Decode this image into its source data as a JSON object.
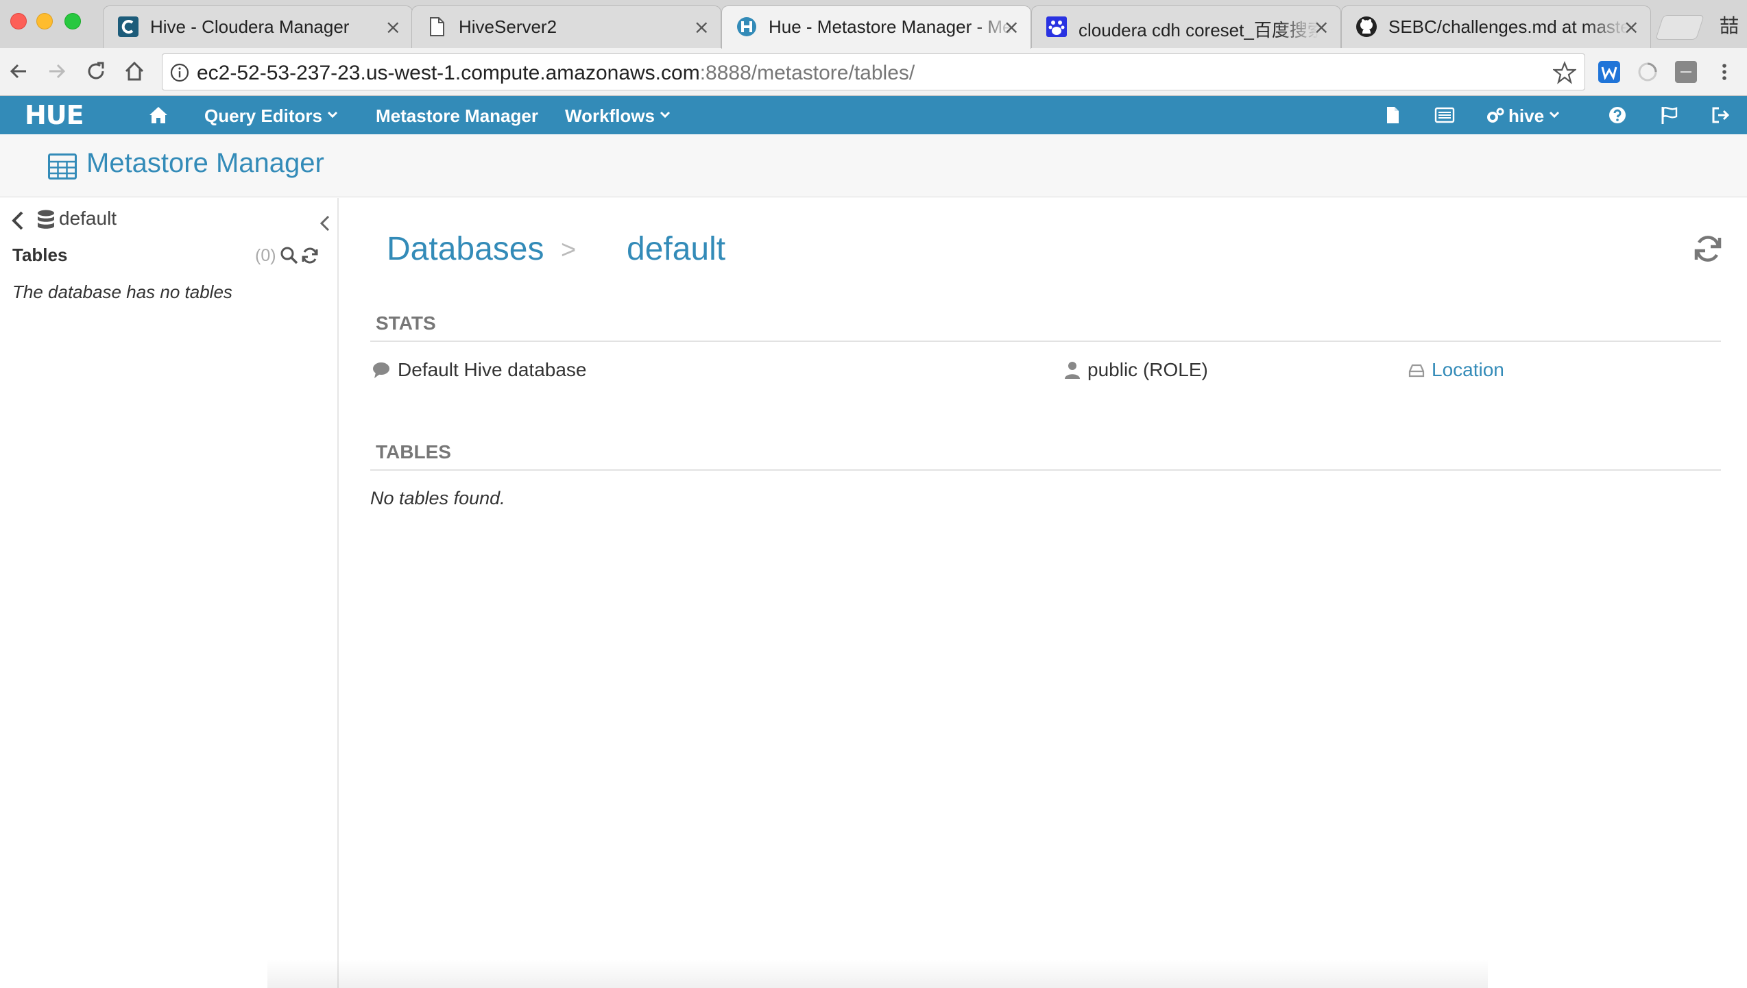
{
  "browser": {
    "tabs": [
      {
        "title": "Hive - Cloudera Manager",
        "icon": "cloudera-icon",
        "active": false
      },
      {
        "title": "HiveServer2",
        "icon": "document-icon",
        "active": false
      },
      {
        "title": "Hue - Metastore Manager - Metastore",
        "icon": "hue-icon",
        "active": true
      },
      {
        "title": "cloudera cdh coreset_百度搜索",
        "icon": "baidu-icon",
        "active": false
      },
      {
        "title": "SEBC/challenges.md at master",
        "icon": "github-icon",
        "active": false
      }
    ],
    "close_glyph": "×",
    "profile_glyph": "喆",
    "url_host": "ec2-52-53-237-23.us-west-1.compute.amazonaws.com",
    "url_rest": ":8888/metastore/tables/"
  },
  "navbar": {
    "logo": "HUE",
    "query_editors": "Query Editors",
    "metastore_manager": "Metastore Manager",
    "workflows": "Workflows",
    "user": "hive",
    "colors": {
      "bar": "#338bb8"
    }
  },
  "page": {
    "title": "Metastore Manager"
  },
  "sidebar": {
    "database": "default",
    "tables_label": "Tables",
    "count": "(0)",
    "empty_message": "The database has no tables"
  },
  "main": {
    "breadcrumb_databases": "Databases",
    "breadcrumb_separator": ">",
    "breadcrumb_current": "default",
    "stats_heading": "STATS",
    "description": "Default Hive database",
    "owner": "public (ROLE)",
    "location": "Location",
    "tables_heading": "TABLES",
    "no_tables": "No tables found."
  }
}
